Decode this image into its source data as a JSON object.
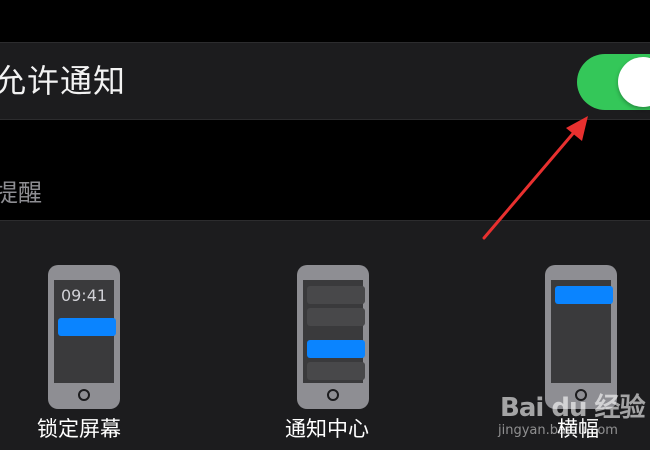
{
  "settings": {
    "allow_notifications_label": "允许通知",
    "allow_notifications_on": true,
    "section_header": "提醒",
    "accent_green": "#34c759",
    "accent_blue": "#0a84ff"
  },
  "alert_styles": [
    {
      "label": "锁定屏幕",
      "time": "09:41"
    },
    {
      "label": "通知中心"
    },
    {
      "label": "横幅"
    }
  ],
  "watermark": {
    "brand": "Bai du 经验",
    "url": "jingyan.baidu.com"
  }
}
